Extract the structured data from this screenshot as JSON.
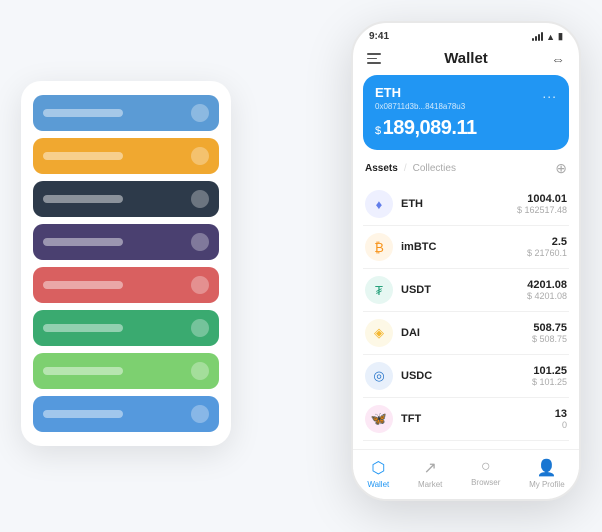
{
  "scene": {
    "background": "#f5f7fa"
  },
  "cardStack": {
    "cards": [
      {
        "color": "#5b9bd5",
        "id": "card-blue"
      },
      {
        "color": "#f0a830",
        "id": "card-yellow"
      },
      {
        "color": "#2d3a4a",
        "id": "card-dark"
      },
      {
        "color": "#4a4070",
        "id": "card-purple"
      },
      {
        "color": "#d96060",
        "id": "card-red"
      },
      {
        "color": "#3aaa70",
        "id": "card-green"
      },
      {
        "color": "#7dd070",
        "id": "card-light-green"
      },
      {
        "color": "#5599dd",
        "id": "card-sky"
      }
    ]
  },
  "phone": {
    "statusBar": {
      "time": "9:41"
    },
    "header": {
      "title": "Wallet"
    },
    "ethCard": {
      "title": "ETH",
      "address": "0x08711d3b...8418a78u3",
      "balance": "189,089.11",
      "currencySymbol": "$",
      "dots": "..."
    },
    "assetsSection": {
      "tabActive": "Assets",
      "tabInactive": "Collecties",
      "divider": "/"
    },
    "assets": [
      {
        "name": "ETH",
        "amount": "1004.01",
        "usd": "$ 162517.48",
        "iconColor": "#627eea",
        "iconText": "♦",
        "iconBg": "#eef0ff"
      },
      {
        "name": "imBTC",
        "amount": "2.5",
        "usd": "$ 21760.1",
        "iconColor": "#f7931a",
        "iconText": "₿",
        "iconBg": "#fff5e6"
      },
      {
        "name": "USDT",
        "amount": "4201.08",
        "usd": "$ 4201.08",
        "iconColor": "#26a17b",
        "iconText": "₮",
        "iconBg": "#e6f7f2"
      },
      {
        "name": "DAI",
        "amount": "508.75",
        "usd": "$ 508.75",
        "iconColor": "#f4b731",
        "iconText": "◈",
        "iconBg": "#fdf8e6"
      },
      {
        "name": "USDC",
        "amount": "101.25",
        "usd": "$ 101.25",
        "iconColor": "#2775ca",
        "iconText": "◎",
        "iconBg": "#e8f0fb"
      },
      {
        "name": "TFT",
        "amount": "13",
        "usd": "0",
        "iconColor": "#e91e8c",
        "iconText": "🦋",
        "iconBg": "#fce8f5"
      }
    ],
    "bottomNav": [
      {
        "label": "Wallet",
        "icon": "⬡",
        "active": true
      },
      {
        "label": "Market",
        "icon": "↗",
        "active": false
      },
      {
        "label": "Browser",
        "icon": "○",
        "active": false
      },
      {
        "label": "My Profile",
        "icon": "👤",
        "active": false
      }
    ]
  }
}
